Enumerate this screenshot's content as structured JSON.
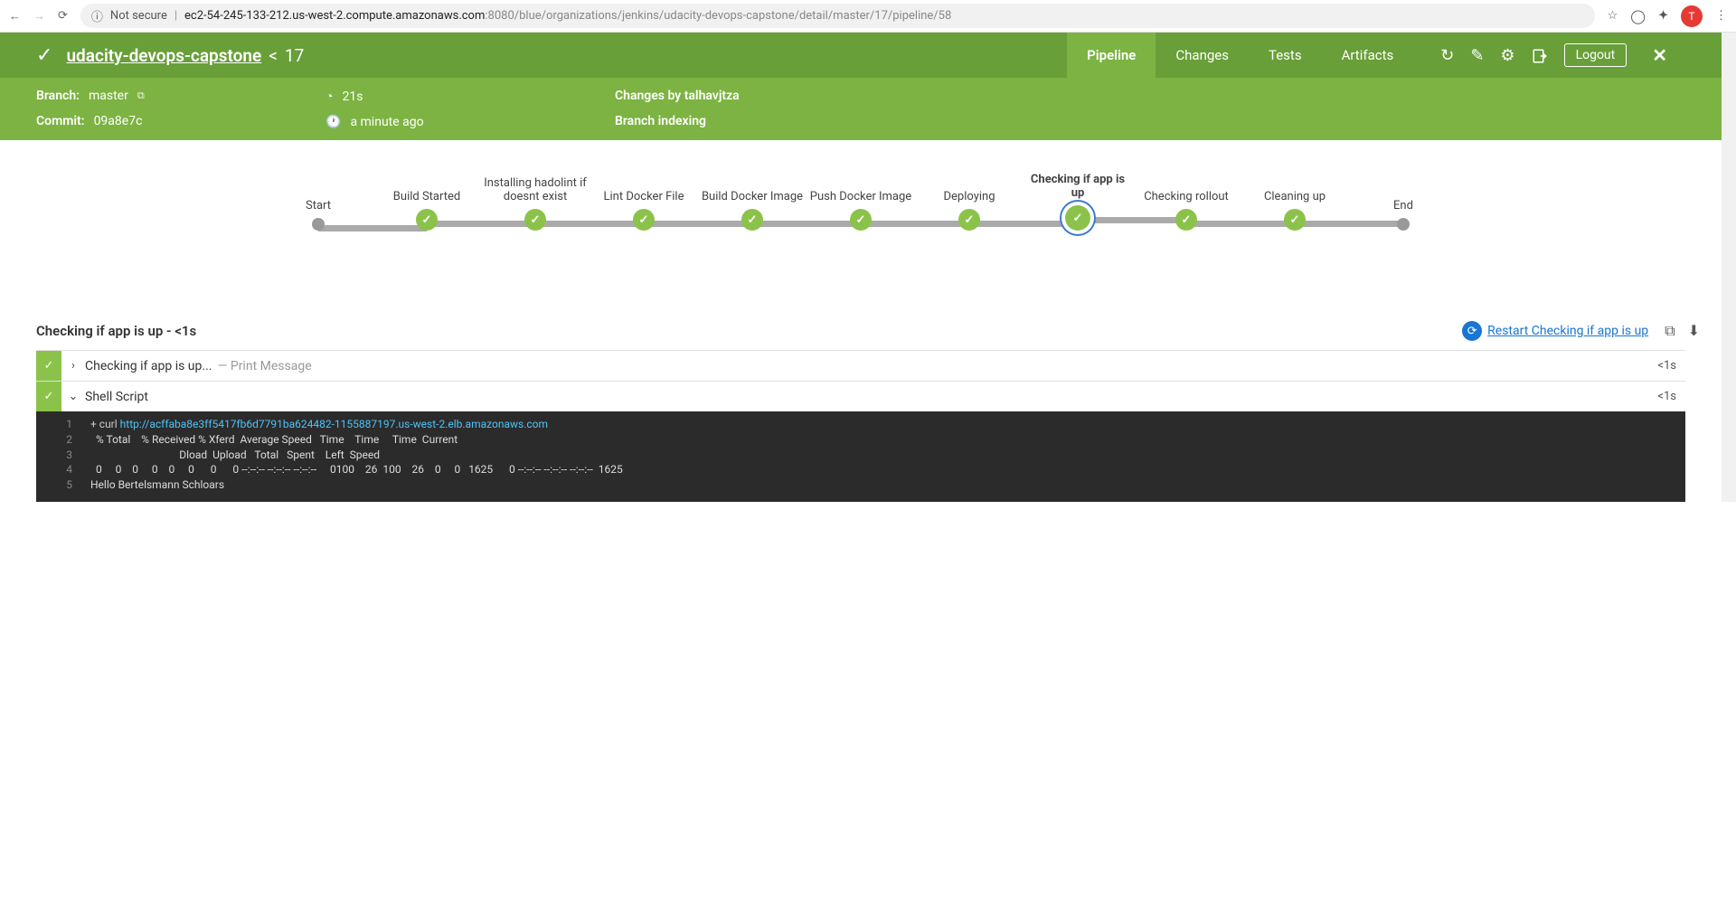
{
  "browser": {
    "insecure_label": "Not secure",
    "url_host": "ec2-54-245-133-212.us-west-2.compute.amazonaws.com",
    "url_path": ":8080/blue/organizations/jenkins/udacity-devops-capstone/detail/master/17/pipeline/58",
    "avatar_letter": "T"
  },
  "header": {
    "project": "udacity-devops-capstone",
    "run_sep": "<",
    "run_number": "17",
    "tabs": [
      "Pipeline",
      "Changes",
      "Tests",
      "Artifacts"
    ],
    "active_tab": 0,
    "logout": "Logout"
  },
  "meta": {
    "branch_label": "Branch:",
    "branch": "master",
    "commit_label": "Commit:",
    "commit": "09a8e7c",
    "duration": "21s",
    "relative_time": "a minute ago",
    "changes_by": "Changes by talhavjtza",
    "cause": "Branch indexing"
  },
  "stages": [
    {
      "label": "Start",
      "state": "terminal"
    },
    {
      "label": "Build Started",
      "state": "ok"
    },
    {
      "label": "Installing hadolint if doesnt exist",
      "state": "ok"
    },
    {
      "label": "Lint Docker File",
      "state": "ok"
    },
    {
      "label": "Build Docker Image",
      "state": "ok"
    },
    {
      "label": "Push Docker Image",
      "state": "ok"
    },
    {
      "label": "Deploying",
      "state": "ok"
    },
    {
      "label": "Checking if app is up",
      "state": "selected"
    },
    {
      "label": "Checking rollout",
      "state": "ok"
    },
    {
      "label": "Cleaning up",
      "state": "ok"
    },
    {
      "label": "End",
      "state": "terminal"
    }
  ],
  "log": {
    "section_title": "Checking if app is up - <1s",
    "restart_label": "Restart Checking if app is up",
    "steps": [
      {
        "name": "Checking if app is up...",
        "desc": "— Print Message",
        "expanded": false,
        "duration": "<1s"
      },
      {
        "name": "Shell Script",
        "desc": "",
        "expanded": true,
        "duration": "<1s"
      }
    ],
    "console": {
      "curl_prefix": "+ curl ",
      "curl_url": "http://acffaba8e3ff5417fb6d7791ba624482-1155887197.us-west-2.elb.amazonaws.com",
      "lines": [
        "  % Total    % Received % Xferd  Average Speed   Time    Time     Time  Current",
        "                                 Dload  Upload   Total   Spent    Left  Speed",
        "  0     0    0     0    0     0      0      0 --:--:-- --:--:-- --:--:--     0100    26  100    26    0     0   1625      0 --:--:-- --:--:-- --:--:--  1625",
        "Hello Bertelsmann Schloars"
      ]
    }
  }
}
